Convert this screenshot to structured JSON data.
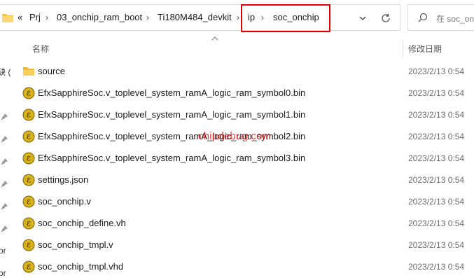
{
  "address_bar": {
    "overflow_label": "«",
    "breadcrumbs": [
      "Prj",
      "03_onchip_ram_boot",
      "Ti180M484_devkit",
      "ip",
      "soc_onchip"
    ]
  },
  "search": {
    "placeholder": "在 soc_on"
  },
  "nav": {
    "fragments": [
      "缺 (",
      "or",
      "or"
    ]
  },
  "columns": {
    "name": "名称",
    "date": "修改日期"
  },
  "files": [
    {
      "name": "source",
      "type": "folder",
      "date": "2023/2/13 0:54"
    },
    {
      "name": "EfxSapphireSoc.v_toplevel_system_ramA_logic_ram_symbol0.bin",
      "type": "efinity",
      "date": "2023/2/13 0:54"
    },
    {
      "name": "EfxSapphireSoc.v_toplevel_system_ramA_logic_ram_symbol1.bin",
      "type": "efinity",
      "date": "2023/2/13 0:54"
    },
    {
      "name": "EfxSapphireSoc.v_toplevel_system_ramA_logic_ram_symbol2.bin",
      "type": "efinity",
      "date": "2023/2/13 0:54"
    },
    {
      "name": "EfxSapphireSoc.v_toplevel_system_ramA_logic_ram_symbol3.bin",
      "type": "efinity",
      "date": "2023/2/13 0:54"
    },
    {
      "name": "settings.json",
      "type": "efinity",
      "date": "2023/2/13 0:54"
    },
    {
      "name": "soc_onchip.v",
      "type": "efinity",
      "date": "2023/2/13 0:54"
    },
    {
      "name": "soc_onchip_define.vh",
      "type": "efinity",
      "date": "2023/2/13 0:54"
    },
    {
      "name": "soc_onchip_tmpl.v",
      "type": "efinity",
      "date": "2023/2/13 0:54"
    },
    {
      "name": "soc_onchip_tmpl.vhd",
      "type": "efinity",
      "date": "2023/2/13 0:54"
    }
  ],
  "watermark": "chipdebug.com",
  "colors": {
    "highlight_box": "#e00000",
    "watermark": "#e0191a",
    "folder": "#f4c148",
    "file_icon": "#c8a012"
  },
  "icons": {
    "folder": "folder-icon",
    "file": "efinity-file-icon",
    "refresh": "refresh-icon",
    "search": "search-icon",
    "dropdown": "chevron-down-icon",
    "pin": "pin-icon"
  }
}
